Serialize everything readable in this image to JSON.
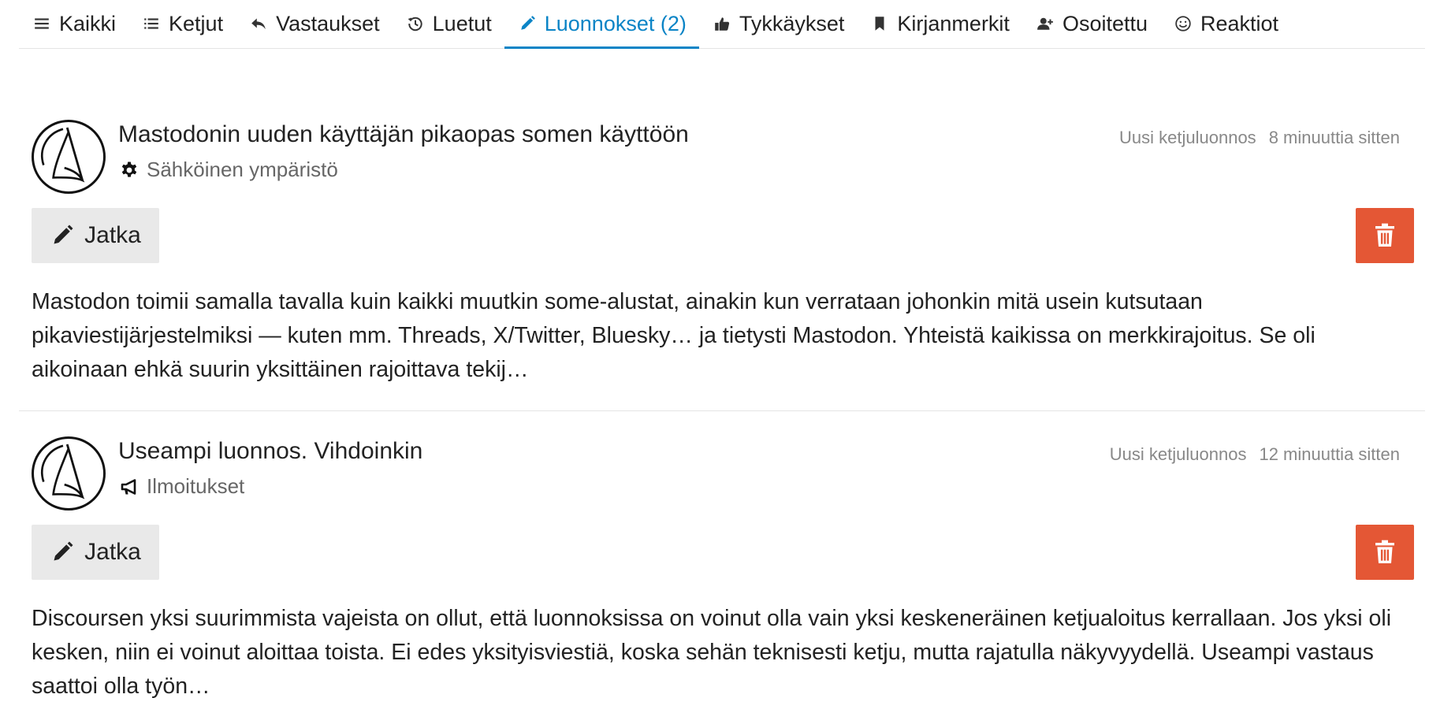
{
  "nav": {
    "items": [
      {
        "label": "Kaikki",
        "icon": "bars-icon"
      },
      {
        "label": "Ketjut",
        "icon": "list-icon"
      },
      {
        "label": "Vastaukset",
        "icon": "reply-icon"
      },
      {
        "label": "Luetut",
        "icon": "history-icon"
      },
      {
        "label": "Luonnokset (2)",
        "icon": "pencil-icon",
        "active": true
      },
      {
        "label": "Tykkäykset",
        "icon": "thumbs-up-icon"
      },
      {
        "label": "Kirjanmerkit",
        "icon": "bookmark-icon"
      },
      {
        "label": "Osoitettu",
        "icon": "user-plus-icon"
      },
      {
        "label": "Reaktiot",
        "icon": "smile-icon"
      }
    ]
  },
  "drafts": [
    {
      "title": "Mastodonin uuden käyttäjän pikaopas somen käyttöön",
      "category": "Sähköinen ympäristö",
      "category_icon": "gear-icon",
      "draft_type": "Uusi ketjuluonnos",
      "time": "8 minuuttia sitten",
      "continue_label": "Jatka",
      "excerpt": "Mastodon toimii samalla tavalla kuin kaikki muutkin some-alustat, ainakin kun verrataan johonkin mitä usein kutsutaan pikaviestijärjestelmiksi — kuten mm. Threads, X/Twitter, Bluesky… ja tietysti Mastodon. Yhteistä kaikissa on merkkirajoitus. Se oli aikoinaan ehkä suurin yksittäinen rajoittava tekij…"
    },
    {
      "title": "Useampi luonnos. Vihdoinkin",
      "category": "Ilmoitukset",
      "category_icon": "bullhorn-icon",
      "draft_type": "Uusi ketjuluonnos",
      "time": "12 minuuttia sitten",
      "continue_label": "Jatka",
      "excerpt": "Discoursen yksi suurimmista vajeista on ollut, että luonnoksissa on voinut olla vain yksi keskeneräinen ketjualoitus kerrallaan. Jos yksi oli kesken, niin ei voinut aloittaa toista. Ei edes yksityisviestiä, koska sehän teknisesti ketju, mutta rajatulla näkyvyydellä. Useampi vastaus saattoi olla työn…"
    }
  ],
  "colors": {
    "accent": "#0a84c6",
    "danger": "#e45735",
    "button_bg": "#e9e9e9",
    "muted_text": "#888888"
  }
}
